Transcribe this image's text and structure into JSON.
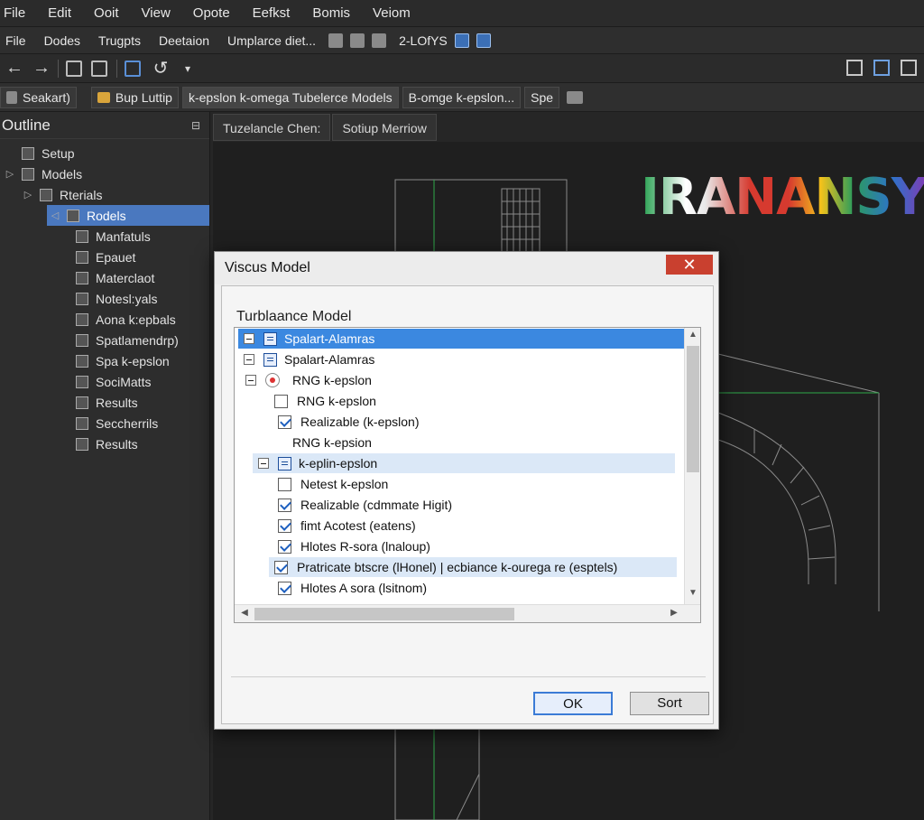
{
  "menubar": [
    "File",
    "Edit",
    "Ooit",
    "View",
    "Opote",
    "Eefkst",
    "Bomis",
    "Veiom"
  ],
  "toolbar2": {
    "items": [
      "File",
      "Dodes",
      "Trugpts",
      "Deetaion",
      "Umplarce diet..."
    ],
    "label_after_icons": "2-LOfYS"
  },
  "tabs": [
    "Seakart)",
    "Bup Luttip",
    "k-epslon k-omega Tubelerce Models",
    "B-omge k-epslon...",
    "Spe"
  ],
  "outline": {
    "title": "Outline",
    "items": [
      {
        "label": "Setup",
        "indent": 0,
        "arrow": ""
      },
      {
        "label": "Models",
        "indent": 0,
        "arrow": "▷"
      },
      {
        "label": "Rterials",
        "indent": 1,
        "arrow": "▷"
      },
      {
        "label": "Rodels",
        "indent": 2,
        "arrow": "◁",
        "selected": true
      },
      {
        "label": "Manfatuls",
        "indent": 3,
        "arrow": ""
      },
      {
        "label": "Epauet",
        "indent": 3,
        "arrow": ""
      },
      {
        "label": "Materclaot",
        "indent": 3,
        "arrow": ""
      },
      {
        "label": "Notesl:yals",
        "indent": 3,
        "arrow": ""
      },
      {
        "label": "Aona k:epbals",
        "indent": 3,
        "arrow": ""
      },
      {
        "label": "Spatlamendrp)",
        "indent": 3,
        "arrow": ""
      },
      {
        "label": "Spa k-epslon",
        "indent": 3,
        "arrow": ""
      },
      {
        "label": "SociMatts",
        "indent": 3,
        "arrow": ""
      },
      {
        "label": "Results",
        "indent": 3,
        "arrow": ""
      },
      {
        "label": "Seccherrils",
        "indent": 3,
        "arrow": ""
      },
      {
        "label": "Results",
        "indent": 3,
        "arrow": ""
      }
    ]
  },
  "viewtabs": [
    "Tuzelancle Chen:",
    "Sotiup Merriow"
  ],
  "logo": "IRANANSYS",
  "dialog": {
    "title": "Viscus Model",
    "close": "✕",
    "section_label": "Turblaance Model",
    "rows": [
      {
        "label": "Spalart-Alamras",
        "kind": "node",
        "state": "highlight"
      },
      {
        "label": "Spalart-Alamras",
        "kind": "node"
      },
      {
        "label": "RNG k-epslon",
        "kind": "radio"
      },
      {
        "label": "RNG k-epslon",
        "kind": "check",
        "checked": false
      },
      {
        "label": "Realizable (k-epslon)",
        "kind": "check",
        "checked": true
      },
      {
        "label": "RNG k-epsion",
        "kind": "text"
      },
      {
        "label": "k-eplin-epslon",
        "kind": "node",
        "state": "soft"
      },
      {
        "label": "Netest k-epslon",
        "kind": "check",
        "checked": false
      },
      {
        "label": "Realizable (cdmmate Higit)",
        "kind": "check",
        "checked": true
      },
      {
        "label": "fimt Acotest (eatens)",
        "kind": "check",
        "checked": true
      },
      {
        "label": "Hlotes R-sora (lnaloup)",
        "kind": "check",
        "checked": true
      },
      {
        "label": "Pratricate btscre (lHonel) | ecbiance k-ouregа re (esptels)",
        "kind": "check",
        "checked": true,
        "state": "soft"
      },
      {
        "label": "Hlotes A sora (lsitnom)",
        "kind": "check",
        "checked": true
      }
    ],
    "ok_label": "OK",
    "sort_label": "Sort"
  },
  "colors": {
    "selection": "#4a78bf",
    "list_highlight": "#3b88e0",
    "close": "#c9402f"
  }
}
